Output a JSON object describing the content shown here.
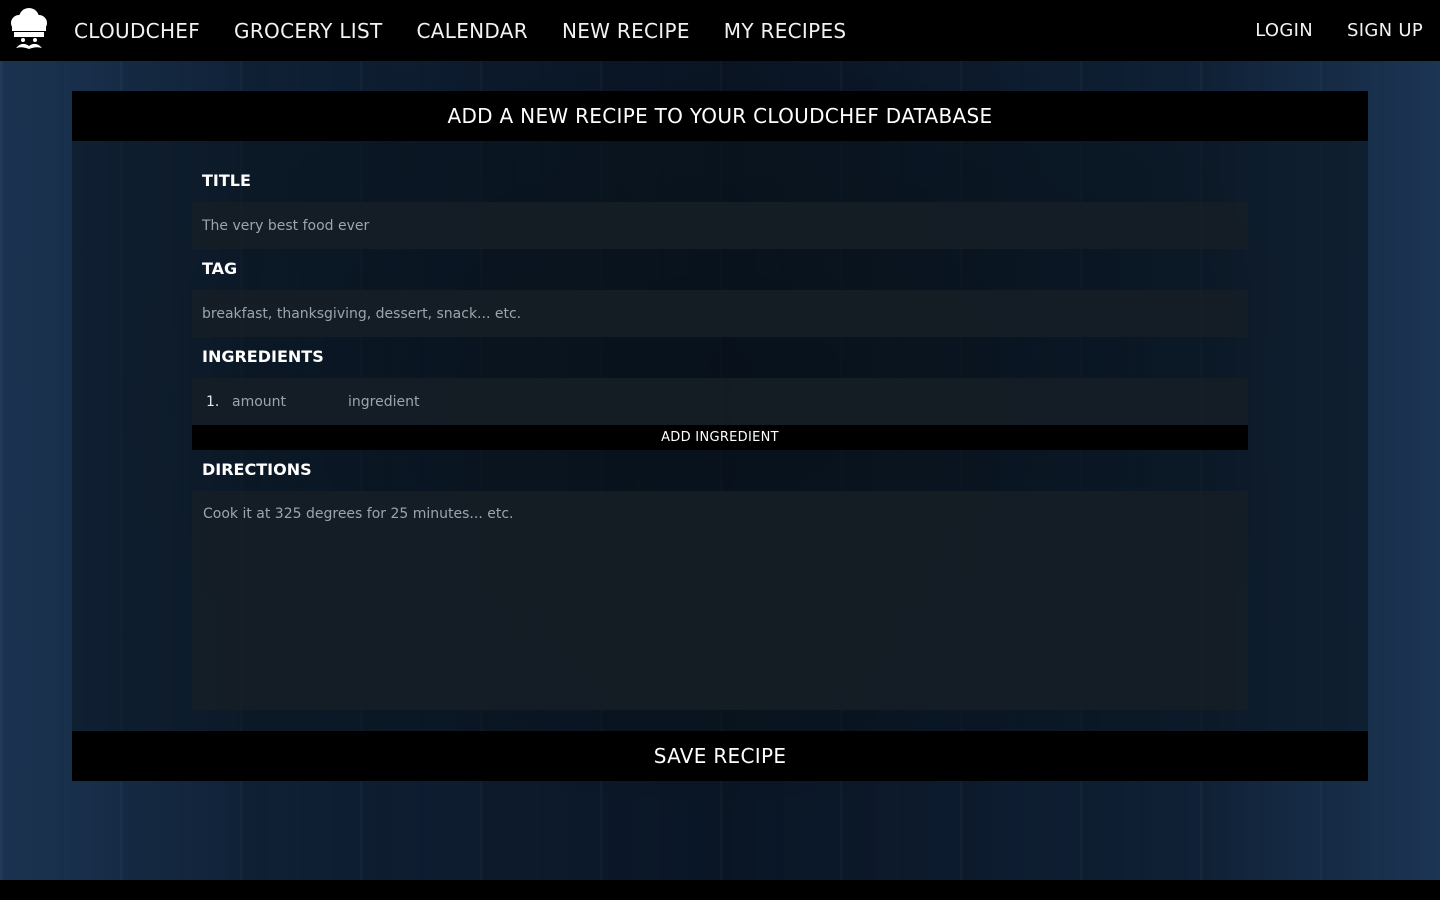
{
  "nav": {
    "brand": "CLOUDCHEF",
    "links": [
      "GROCERY LIST",
      "CALENDAR",
      "NEW RECIPE",
      "MY RECIPES"
    ],
    "login": "LOGIN",
    "signup": "SIGN UP"
  },
  "panel": {
    "header": "ADD A NEW RECIPE TO YOUR CLOUDCHEF DATABASE",
    "title_label": "TITLE",
    "title_placeholder": "The very best food ever",
    "tag_label": "TAG",
    "tag_placeholder": "breakfast, thanksgiving, dessert, snack... etc.",
    "ingredients_label": "INGREDIENTS",
    "ingredients": [
      {
        "number": "1.",
        "amount_placeholder": "amount",
        "ingredient_placeholder": "ingredient"
      }
    ],
    "add_ingredient": "ADD INGREDIENT",
    "directions_label": "DIRECTIONS",
    "directions_placeholder": "Cook it at 325 degrees for 25 minutes... etc.",
    "save": "SAVE RECIPE"
  },
  "icons": {
    "logo": "chef-hat-mustache-icon"
  },
  "colors": {
    "bar": "#000000",
    "input_bg": "#161e26",
    "placeholder": "#9da4ab"
  }
}
